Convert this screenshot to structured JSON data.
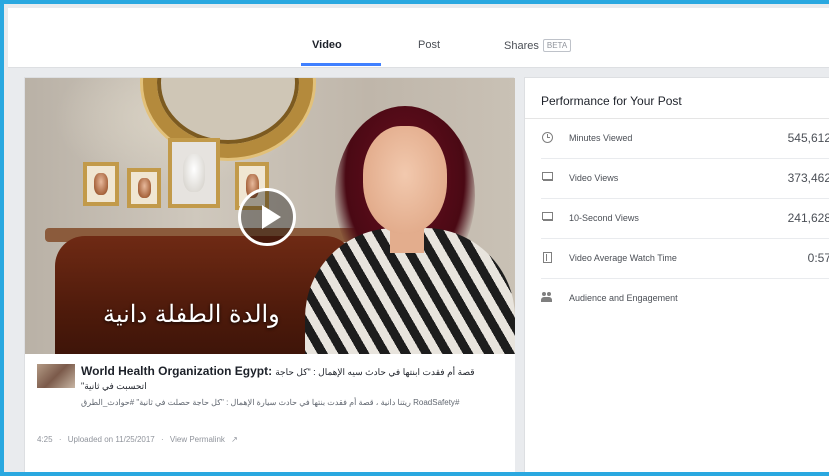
{
  "tabs": [
    {
      "label": "Video",
      "active": true
    },
    {
      "label": "Post",
      "active": false
    },
    {
      "label": "Shares",
      "active": false,
      "badge": "BETA"
    }
  ],
  "video": {
    "overlay_caption": "والدة الطفلة دانية"
  },
  "post": {
    "page_name": "World Health Organization Egypt:",
    "title_arabic": "قصة أم فقدت ابنتها في حادث سيه الإهمال : \"كل حاجة اتحسبت في ثانية\"",
    "subtitle": "#RoadSafety ريتنا دانية ، قصة أم فقدت بنتها في حادث سيارة الإهمال : \"كل حاجة حصلت في ثانية\" #حوادث_الطرق",
    "duration": "4:25",
    "uploaded": "Uploaded on 11/25/2017",
    "permalink": "View Permalink"
  },
  "performance": {
    "title": "Performance for Your Post",
    "metrics": [
      {
        "icon": "clock-icon",
        "label": "Minutes Viewed",
        "value": "545,612"
      },
      {
        "icon": "video-views-icon",
        "label": "Video Views",
        "value": "373,462"
      },
      {
        "icon": "video-views-icon",
        "label": "10-Second Views",
        "value": "241,628"
      },
      {
        "icon": "film-icon",
        "label": "Video Average Watch Time",
        "value": "0:57"
      },
      {
        "icon": "people-icon",
        "label": "Audience and Engagement",
        "value": ""
      }
    ]
  },
  "colors": {
    "accent_border": "#2aa8e0",
    "tab_underline": "#4080ff"
  }
}
